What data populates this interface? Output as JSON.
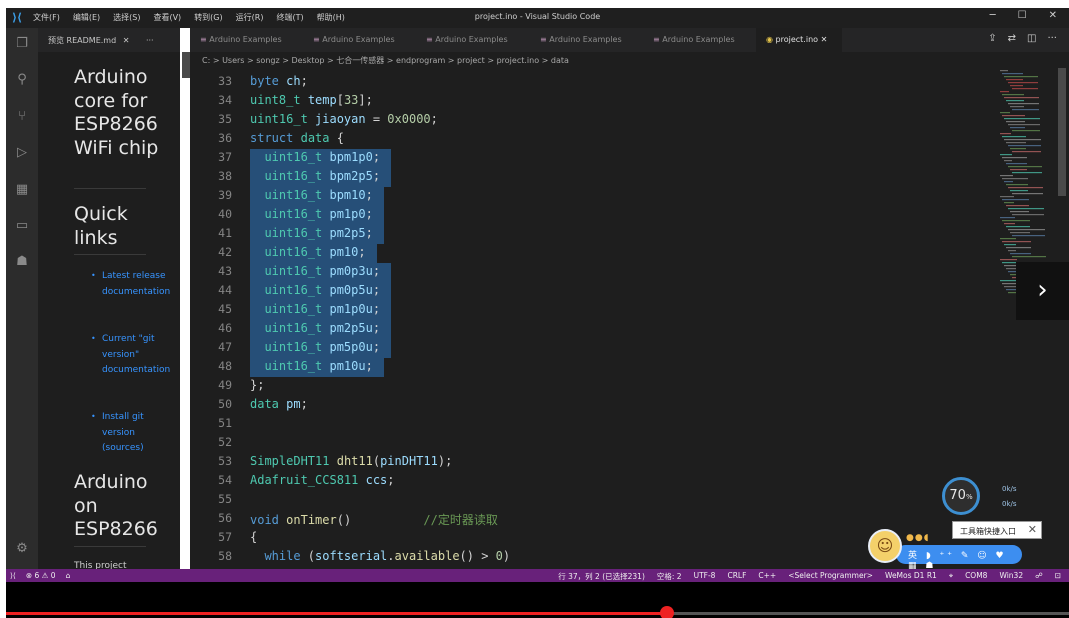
{
  "titlebar": {
    "app_icon": "vscode-icon",
    "menu": [
      "文件(F)",
      "编辑(E)",
      "选择(S)",
      "查看(V)",
      "转到(G)",
      "运行(R)",
      "终端(T)",
      "帮助(H)"
    ],
    "title": "project.ino - Visual Studio Code",
    "window_controls": [
      "─",
      "☐",
      "✕"
    ]
  },
  "activity_bar": [
    "explorer-icon",
    "search-icon",
    "source-control-icon",
    "run-debug-icon",
    "extensions-icon",
    "remote-explorer-icon",
    "alien-icon",
    "gear-icon"
  ],
  "readme_tab": {
    "label": "预览 README.md",
    "close": "✕",
    "more": "···"
  },
  "readme": {
    "heading1": "Arduino core for ESP8266 WiFi chip",
    "heading2": "Quick links",
    "links": [
      "Latest release documentation",
      "Current \"git version\" documentation",
      "Install git version (sources)"
    ],
    "heading3": "Arduino on ESP8266",
    "trailing": "This project"
  },
  "tabs": [
    {
      "label": "Arduino Examples",
      "active": false
    },
    {
      "label": "Arduino Examples",
      "active": false
    },
    {
      "label": "Arduino Examples",
      "active": false
    },
    {
      "label": "Arduino Examples",
      "active": false
    },
    {
      "label": "Arduino Examples",
      "active": false
    },
    {
      "label": "project.ino",
      "active": true,
      "close": "✕"
    }
  ],
  "tab_actions": [
    "⇪",
    "⇄",
    "◫",
    "···"
  ],
  "breadcrumb": "C: > Users > songz > Desktop > 七合一传感器 > endprogram > project > project.ino > data",
  "editor": {
    "lines": [
      {
        "n": "33",
        "t": "byte ch;"
      },
      {
        "n": "34",
        "t": "uint8_t temp[33];"
      },
      {
        "n": "35",
        "t": "uint16_t jiaoyan = 0x0000;"
      },
      {
        "n": "36",
        "t": "struct data {"
      },
      {
        "n": "37",
        "t": "  uint16_t bpm1p0;"
      },
      {
        "n": "38",
        "t": "  uint16_t bpm2p5;"
      },
      {
        "n": "39",
        "t": "  uint16_t bpm10;"
      },
      {
        "n": "40",
        "t": "  uint16_t pm1p0;"
      },
      {
        "n": "41",
        "t": "  uint16_t pm2p5;"
      },
      {
        "n": "42",
        "t": "  uint16_t pm10;"
      },
      {
        "n": "43",
        "t": "  uint16_t pm0p3u;"
      },
      {
        "n": "44",
        "t": "  uint16_t pm0p5u;"
      },
      {
        "n": "45",
        "t": "  uint16_t pm1p0u;"
      },
      {
        "n": "46",
        "t": "  uint16_t pm2p5u;"
      },
      {
        "n": "47",
        "t": "  uint16_t pm5p0u;"
      },
      {
        "n": "48",
        "t": "  uint16_t pm10u;"
      },
      {
        "n": "49",
        "t": "};"
      },
      {
        "n": "50",
        "t": "data pm;"
      },
      {
        "n": "51",
        "t": ""
      },
      {
        "n": "52",
        "t": ""
      },
      {
        "n": "53",
        "t": "SimpleDHT11 dht11(pinDHT11);"
      },
      {
        "n": "54",
        "t": "Adafruit_CCS811 ccs;"
      },
      {
        "n": "55",
        "t": ""
      },
      {
        "n": "56",
        "t": "void onTimer()          //定时器读取"
      },
      {
        "n": "57",
        "t": "{"
      },
      {
        "n": "58",
        "t": "  while (softserial.available() > 0)"
      }
    ],
    "selected_lines": [
      "37",
      "38",
      "39",
      "40",
      "41",
      "42",
      "43",
      "44",
      "45",
      "46",
      "47",
      "48"
    ]
  },
  "status": {
    "left": [
      "⟩⟨",
      "⊗ 6 ⚠ 0",
      "⌂"
    ],
    "right": [
      "行 37，列 2 (已选择231)",
      "空格: 2",
      "UTF-8",
      "CRLF",
      "C++",
      "<Select Programmer>",
      "WeMos D1 R1",
      "⌖",
      "COM8",
      "Win32",
      "☍",
      "⊡"
    ]
  },
  "overlay": {
    "perf_value": "70",
    "perf_unit": "%",
    "perf_rate1": "0k/s",
    "perf_rate2": "0k/s",
    "tooltip": "工具箱快捷入口",
    "tooltip_close": "✕",
    "ime_keys": "英 ◗ ⁺⁺ ✎ ☺ ♥ ▦ ☗",
    "ime_dots": "●●◖"
  },
  "video": {
    "next_label": "›",
    "progress": 0.622
  }
}
